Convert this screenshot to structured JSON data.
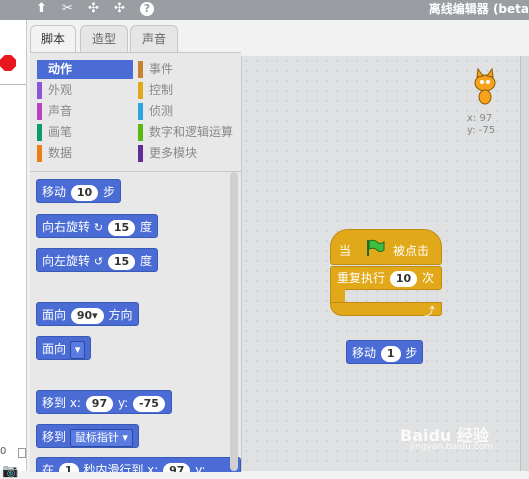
{
  "topbar": {
    "title": "离线编辑器 (beta",
    "icons": [
      "stamp-icon",
      "scissors-icon",
      "grow-icon",
      "shrink-icon",
      "help-icon"
    ],
    "icon_glyphs": [
      "⬆",
      "✂",
      "✣",
      "✣",
      "?"
    ]
  },
  "tabs": [
    {
      "label": "脚本",
      "active": true
    },
    {
      "label": "造型",
      "active": false
    },
    {
      "label": "声音",
      "active": false
    }
  ],
  "categories": [
    {
      "label": "动作",
      "color": "#4a6cd4",
      "selected": true
    },
    {
      "label": "外观",
      "color": "#8a55d7",
      "selected": false
    },
    {
      "label": "声音",
      "color": "#bb42c3",
      "selected": false
    },
    {
      "label": "画笔",
      "color": "#0e9a6c",
      "selected": false
    },
    {
      "label": "数据",
      "color": "#ee7d16",
      "selected": false
    },
    {
      "label": "事件",
      "color": "#c88330",
      "selected": false
    },
    {
      "label": "控制",
      "color": "#e1a91a",
      "selected": false
    },
    {
      "label": "侦测",
      "color": "#2ca5e2",
      "selected": false
    },
    {
      "label": "数字和逻辑运算",
      "color": "#5cb712",
      "selected": false
    },
    {
      "label": "更多模块",
      "color": "#632d99",
      "selected": false
    }
  ],
  "palette_blocks": {
    "move": {
      "text": "移动",
      "value": "10",
      "suffix": "步"
    },
    "turn_right": {
      "text": "向右旋转",
      "icon": "↻",
      "value": "15",
      "suffix": "度"
    },
    "turn_left": {
      "text": "向左旋转",
      "icon": "↺",
      "value": "15",
      "suffix": "度"
    },
    "point_dir": {
      "text": "面向",
      "value": "90▾",
      "suffix": "方向"
    },
    "point_towards": {
      "text": "面向",
      "value": "▾"
    },
    "goto_xy": {
      "text": "移到 x:",
      "x": "97",
      "ylabel": "y:",
      "y": "-75"
    },
    "goto": {
      "text": "移到",
      "value": "鼠标指针 ▾"
    },
    "glide": {
      "text": "在",
      "secs": "1",
      "mid": "秒内滑行到 x:",
      "x": "97",
      "ylabel": "y:"
    }
  },
  "stage": {
    "x_label": "x:",
    "x": "97",
    "y_label": "y:",
    "y": "-75"
  },
  "script": {
    "hat": {
      "prefix": "当",
      "suffix": "被点击"
    },
    "repeat": {
      "text": "重复执行",
      "value": "10",
      "suffix": "次"
    },
    "loose": {
      "text": "移动",
      "value": "1",
      "suffix": "步"
    }
  },
  "left": {
    "zero": "0"
  },
  "watermark": {
    "main": "Baidu 经验",
    "sub": "jingyan.baidu.com"
  }
}
